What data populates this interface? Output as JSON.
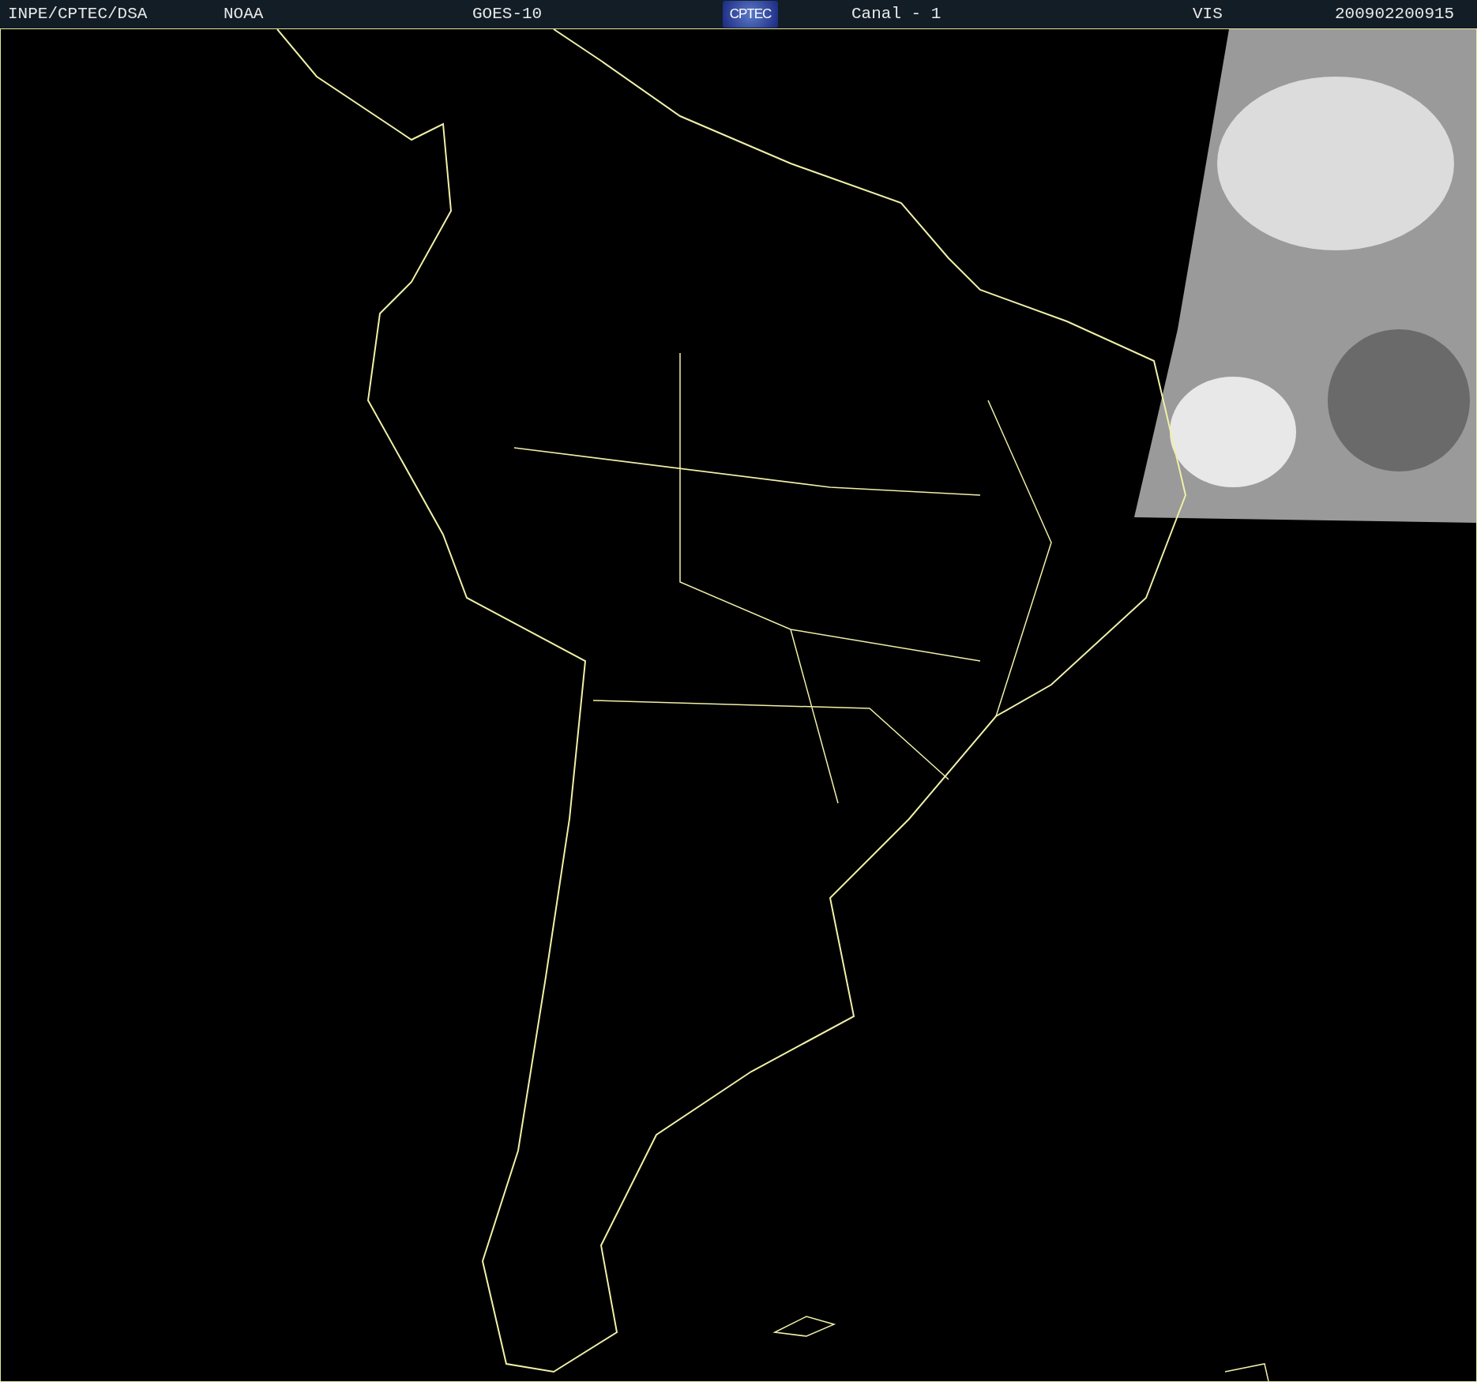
{
  "header": {
    "items": [
      {
        "kind": "text",
        "text": "INPE/CPTEC/DSA"
      },
      {
        "kind": "text",
        "text": "NOAA"
      },
      {
        "kind": "text",
        "text": "GOES-10"
      },
      {
        "kind": "logo",
        "text": "CPTEC"
      },
      {
        "kind": "text",
        "text": "Canal - 1"
      },
      {
        "kind": "text",
        "text": "VIS"
      },
      {
        "kind": "text",
        "text": "200902200915"
      }
    ]
  }
}
